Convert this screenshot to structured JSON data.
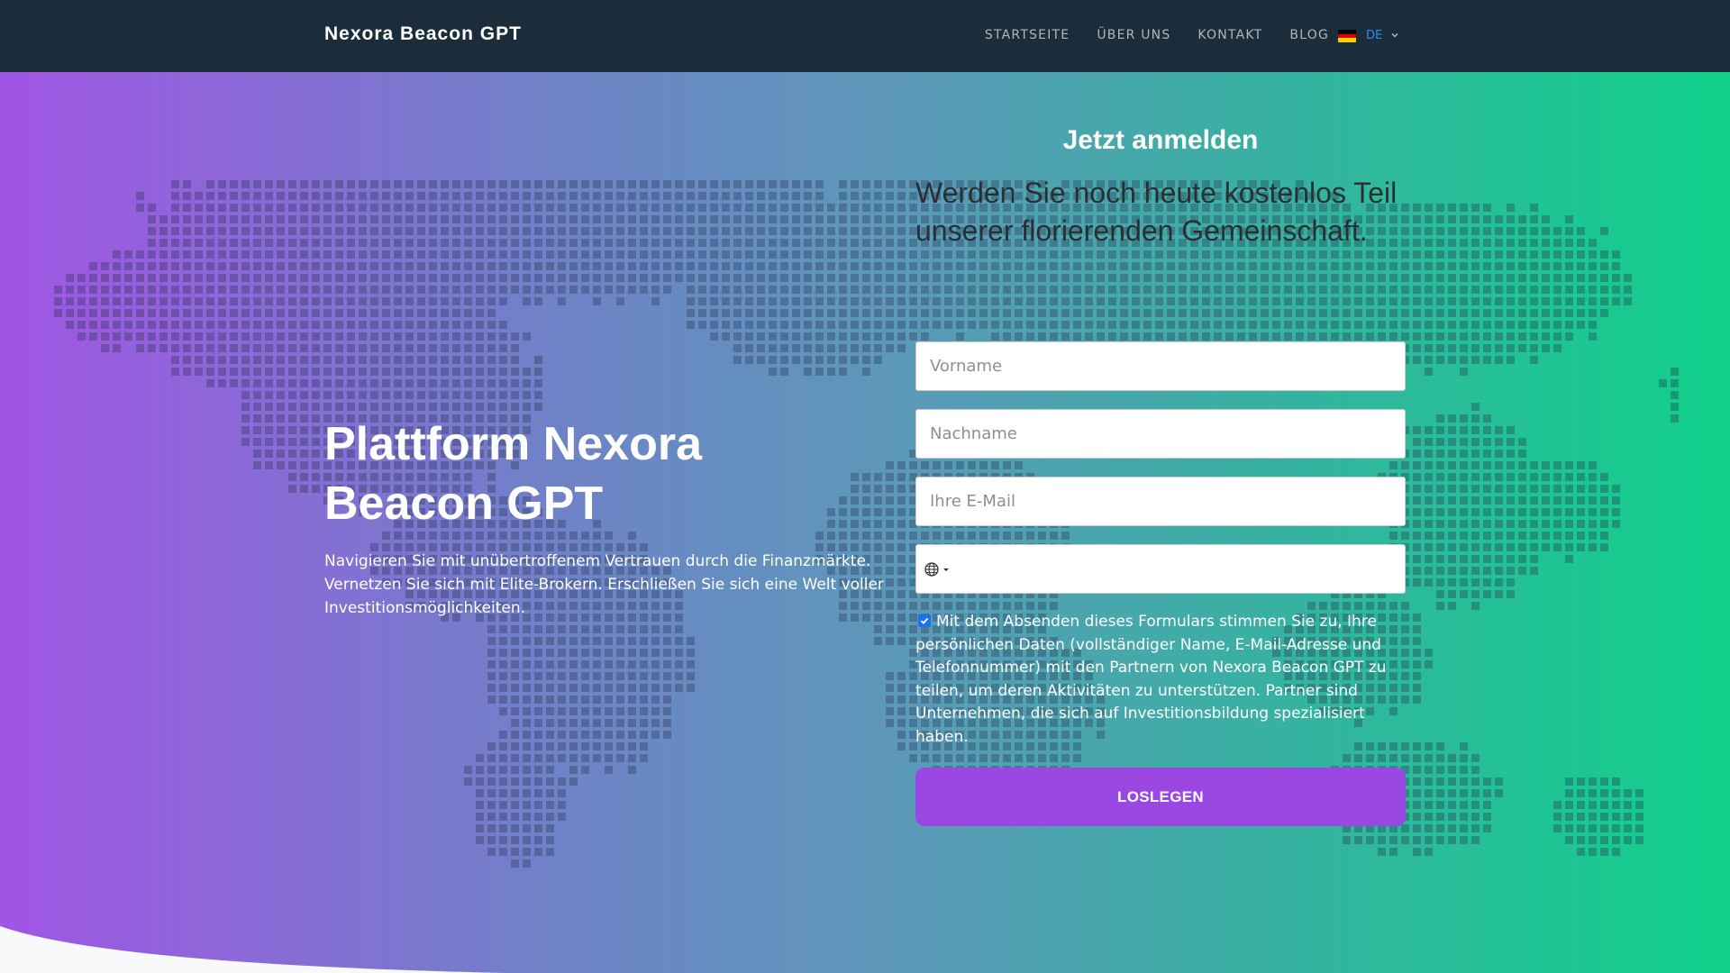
{
  "navbar": {
    "brand": "Nexora Beacon GPT",
    "links": [
      "STARTSEITE",
      "ÜBER UNS",
      "KONTAKT",
      "BLOG"
    ],
    "language": {
      "code": "DE",
      "flag_icon": "germany-flag-icon"
    }
  },
  "hero": {
    "title_regular": "Plattform ",
    "title_bold": "Nexora Beacon GPT",
    "subtitle": "Navigieren Sie mit unübertroffenem Vertrauen durch die Finanzmärkte. Vernetzen Sie sich mit Elite-Brokern. Erschließen Sie sich eine Welt voller Investitionsmöglichkeiten."
  },
  "form": {
    "title": "Jetzt anmelden",
    "lead": "Werden Sie noch heute kostenlos Teil unserer florierenden Gemeinschaft.",
    "firstname_placeholder": "Vorname",
    "lastname_placeholder": "Nachname",
    "email_placeholder": "Ihre E-Mail",
    "phone_value": "",
    "phone_country_icon": "globe-icon",
    "consent_checked": true,
    "consent_text": "Mit dem Absenden dieses Formulars stimmen Sie zu, Ihre persönlichen Daten (vollständiger Name, E-Mail-Adresse und Telefonnummer) mit den Partnern von Nexora Beacon GPT zu teilen, um deren Aktivitäten zu unterstützen. Partner sind Unternehmen, die sich auf Investitionsbildung spezialisiert haben.",
    "submit_label": "LOSLEGEN"
  },
  "colors": {
    "navbar_bg": "#1b2d3a",
    "gradient_start": "#a155e4",
    "gradient_end": "#10d08a",
    "button_bg": "#9b48e2",
    "lang_accent": "#3b8bea"
  }
}
